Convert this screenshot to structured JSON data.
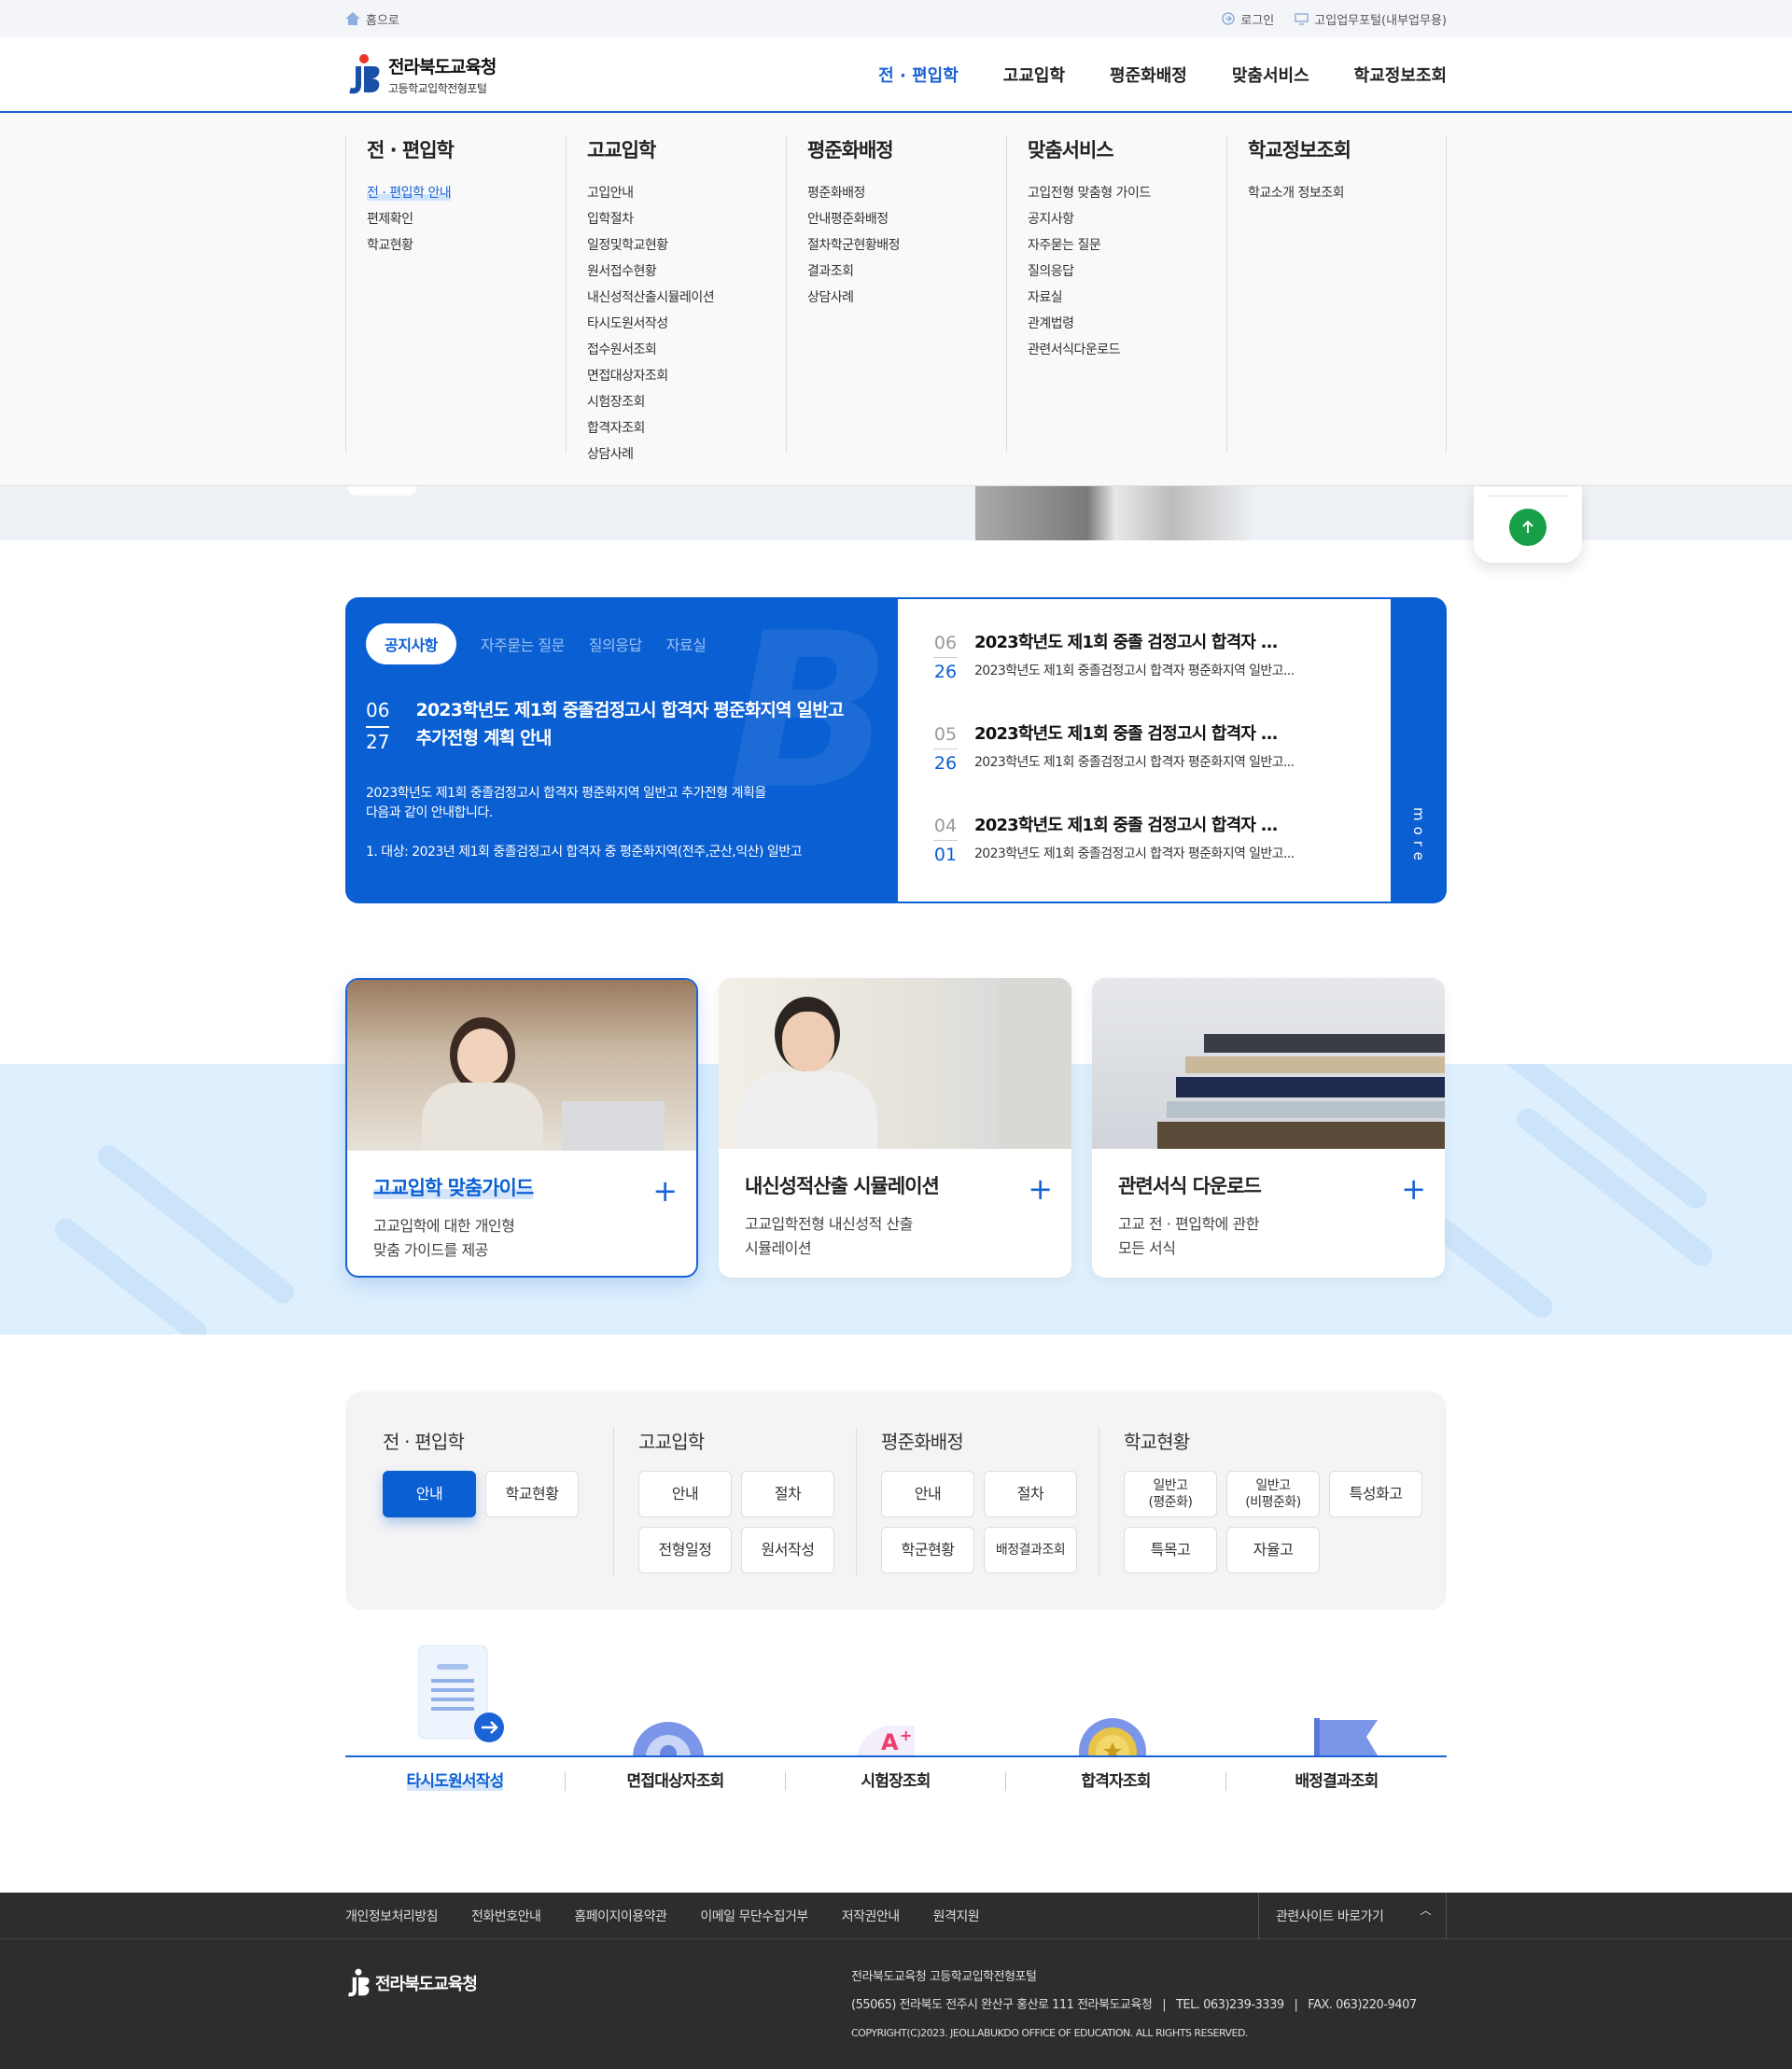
{
  "topbar": {
    "home": "홈으로",
    "login": "로그인",
    "portal": "고입업무포털(내부업무용)"
  },
  "logo": {
    "title": "전라북도교육청",
    "subtitle": "고등학교입학전형포털"
  },
  "gnb": [
    "전 · 편입학",
    "고교입학",
    "평준화배정",
    "맞춤서비스",
    "학교정보조회"
  ],
  "mega": [
    {
      "title": "전 · 편입학",
      "items": [
        "전 · 편입학 안내",
        "편제확인",
        "학교현황"
      ]
    },
    {
      "title": "고교입학",
      "items": [
        "고입안내",
        "입학절차",
        "일정및학교현황",
        "원서접수현황",
        "내신성적산출시뮬레이션",
        "타시도원서작성",
        "접수원서조회",
        "면접대상자조회",
        "시험장조회",
        "합격자조회",
        "상담사례"
      ]
    },
    {
      "title": "평준화배정",
      "items": [
        "평준화배정",
        "안내평준화배정",
        "절차학군현황배정",
        "결과조회",
        "상담사례"
      ]
    },
    {
      "title": "맞춤서비스",
      "items": [
        "고입전형 맞춤형 가이드",
        "공지사항",
        "자주묻는 질문",
        "질의응답",
        "자료실",
        "관계법령",
        "관련서식다운로드"
      ]
    },
    {
      "title": "학교정보조회",
      "items": [
        "학교소개 정보조회"
      ]
    }
  ],
  "board": {
    "tabs": [
      "공지사항",
      "자주묻는 질문",
      "질의응답",
      "자료실"
    ],
    "featured": {
      "month": "06",
      "day": "27",
      "title1": "2023학년도 제1회 중졸검정고시 합격자 평준화지역 일반고",
      "title2": "추가전형 계획 안내",
      "desc1": "2023학년도 제1회 중졸검정고시 합격자 평준화지역 일반고 추가전형 계획을",
      "desc2": "다음과 같이 안내합니다.",
      "desc3": "1. 대상: 2023년 제1회 중졸검정고시 합격자 중 평준화지역(전주,군산,익산) 일반고"
    },
    "list": [
      {
        "month": "06",
        "day": "26",
        "title": "2023학년도 제1회 중졸 검정고시 합격자 ...",
        "sub": "2023학년도 제1회 중졸검정고시 합격자 평준화지역 일반고..."
      },
      {
        "month": "05",
        "day": "26",
        "title": "2023학년도 제1회 중졸 검정고시 합격자 ...",
        "sub": "2023학년도 제1회 중졸검정고시 합격자 평준화지역 일반고..."
      },
      {
        "month": "04",
        "day": "01",
        "title": "2023학년도 제1회 중졸 검정고시 합격자 ...",
        "sub": "2023학년도 제1회 중졸검정고시 합격자 평준화지역 일반고..."
      }
    ],
    "more": "more"
  },
  "cards": [
    {
      "title": "고교입학 맞춤가이드",
      "desc1": "고교입학에 대한 개인형",
      "desc2": "맞춤 가이드를 제공"
    },
    {
      "title": "내신성적산출 시뮬레이션",
      "desc1": "고교입학전형 내신성적 산출",
      "desc2": "시뮬레이션"
    },
    {
      "title": "관련서식 다운로드",
      "desc1": "고교 전 · 편입학에 관한",
      "desc2": "모든 서식"
    }
  ],
  "quicklinks": [
    {
      "title": "전 · 편입학",
      "buttons": [
        "안내",
        "학교현황"
      ]
    },
    {
      "title": "고교입학",
      "buttons": [
        "안내",
        "절차",
        "전형일정",
        "원서작성"
      ]
    },
    {
      "title": "평준화배정",
      "buttons": [
        "안내",
        "절차",
        "학군현황",
        "배정결과조회"
      ]
    },
    {
      "title": "학교현황",
      "buttons": [
        "일반고\n(평준화)",
        "일반고\n(비평준화)",
        "특성화고",
        "특목고",
        "자율고"
      ]
    }
  ],
  "icons": [
    "타시도원서작성",
    "면접대상자조회",
    "시험장조회",
    "합격자조회",
    "배정결과조회"
  ],
  "footer": {
    "links": [
      "개인정보처리방침",
      "전화번호안내",
      "홈페이지이용약관",
      "이메일 무단수집거부",
      "저작권안내",
      "원격지원"
    ],
    "related": "관련사이트 바로가기",
    "logo": "전라북도교육청",
    "line1": "전라북도교육청 고등학교입학전형포털",
    "line2": "(55065) 전라북도 전주시 완산구 홍산로 111 전라북도교육청   |   TEL. 063)239-3339   |   FAX. 063)220-9407",
    "copyright": "COPYRIGHT(C)2023. JEOLLABUKDO OFFICE OF EDUCATION. ALL RIGHTS RESERVED."
  }
}
